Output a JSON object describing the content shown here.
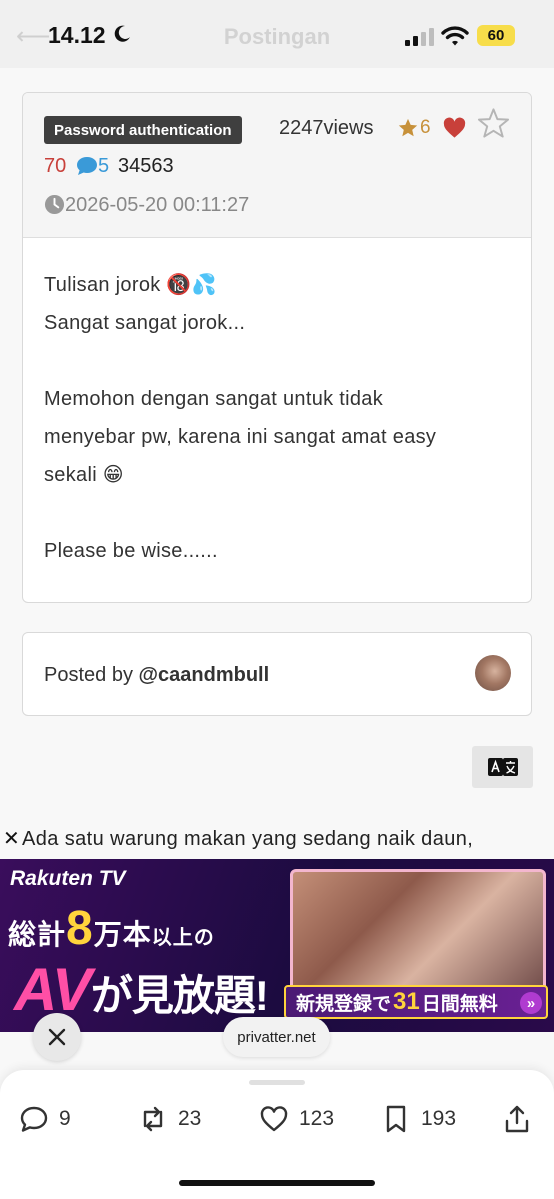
{
  "status_bar": {
    "time": "14.12",
    "battery": "60"
  },
  "header": {
    "title": "Postingan"
  },
  "post": {
    "auth_badge": "Password authentication",
    "views": "2247views",
    "star_count": "6",
    "likes": "70",
    "comments": "5",
    "pw_number": "34563",
    "date": "2026-05-20 00:11:27",
    "body_lines": [
      "Tulisan jorok 🔞💦",
      "Sangat sangat jorok...",
      "",
      "Memohon dengan sangat untuk tidak",
      "menyebar pw, karena ini sangat amat easy",
      "sekali 😁",
      "",
      "Please be wise......"
    ]
  },
  "author": {
    "prefix": "Posted by",
    "handle": "@caandmbull"
  },
  "ad": {
    "text": "Ada satu warung makan yang sedang naik daun,",
    "brand": "Rakuten",
    "brand_tv": "TV",
    "line1_prefix": "総計",
    "line1_num": "8",
    "line1_unit": "万本",
    "line1_suffix": "以上の",
    "line2_av": "AV",
    "line2_rest": "が見放題!",
    "cta_prefix": "新規登録で",
    "cta_days": "31",
    "cta_suffix": "日間無料"
  },
  "domain_pill": "privatter.net",
  "actions": {
    "replies": "9",
    "reposts": "23",
    "likes": "123",
    "bookmarks": "193"
  },
  "colors": {
    "star_gold": "#c7913a",
    "heart_red": "#c8403a",
    "comment_blue": "#3a9ad8",
    "badge_dark": "#3f3f3f",
    "battery_yellow": "#f7dd4a"
  }
}
